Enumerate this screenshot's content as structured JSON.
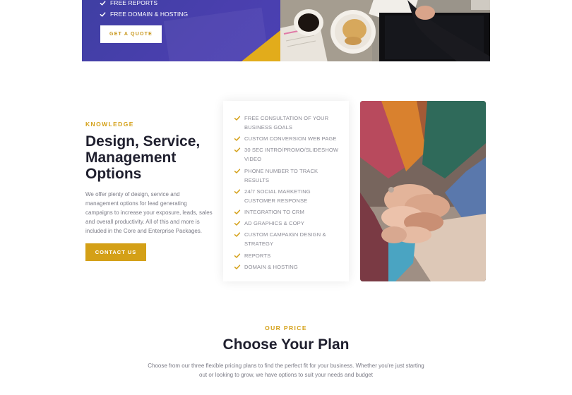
{
  "hero": {
    "features": [
      "FREE REPORTS",
      "FREE DOMAIN & HOSTING"
    ],
    "cta_label": "GET A QUOTE",
    "colors": {
      "panel": "#4a3fae",
      "accent": "#e2ac1b"
    }
  },
  "knowledge": {
    "eyebrow": "KNOWLEDGE",
    "title": "Design, Service, Management Options",
    "body": "We offer plenty of design, service and management options for lead generating campaigns to increase your exposure, leads, sales and overall productivity. All of this and more is included in the Core and Enterprise Packages.",
    "cta_label": "CONTACT US",
    "features": [
      "FREE CONSULTATION OF YOUR BUSINESS GOALS",
      "CUSTOM CONVERSION WEB PAGE",
      "30 SEC INTRO/PROMO/SLIDESHOW VIDEO",
      "PHONE NUMBER TO TRACK RESULTS",
      "24/7 SOCIAL MARKETING CUSTOMER RESPONSE",
      "INTEGRATION TO CRM",
      "AD GRAPHICS & COPY",
      "CUSTOM CAMPAIGN DESIGN & STRATEGY",
      "REPORTS",
      "DOMAIN & HOSTING"
    ],
    "check_icon": "check-icon",
    "colors": {
      "accent": "#d4a017"
    }
  },
  "pricing": {
    "eyebrow": "OUR PRICE",
    "title": "Choose Your Plan",
    "body": "Choose from our three flexible pricing plans to find the perfect fit for your business. Whether you're just starting out or looking to grow, we have options to suit your needs and budget"
  }
}
